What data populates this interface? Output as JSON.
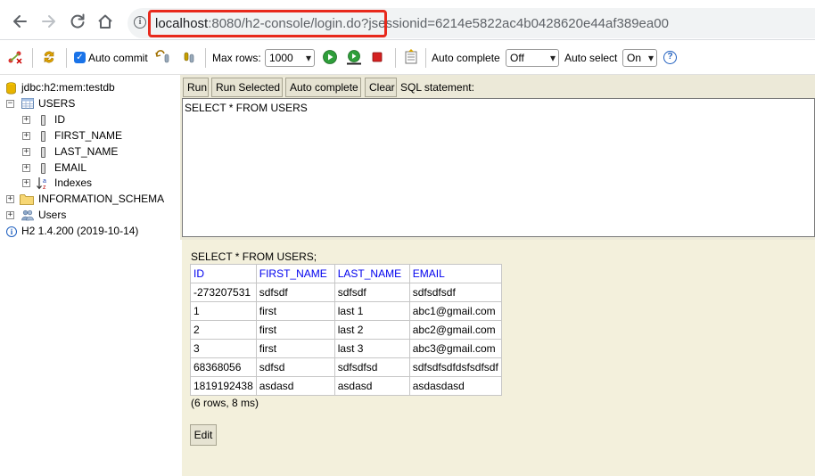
{
  "browser": {
    "url_host": "localhost",
    "url_rest": ":8080/h2-console/login.do?jsessionid=6214e5822ac4b0428620e44af389ea00",
    "info_icon": "info-icon"
  },
  "toolbar": {
    "auto_commit_label": "Auto commit",
    "max_rows_label": "Max rows:",
    "max_rows_value": "1000",
    "auto_complete_label": "Auto complete",
    "auto_complete_value": "Off",
    "auto_select_label": "Auto select",
    "auto_select_value": "On",
    "help_icon": "?"
  },
  "tree": {
    "connection": "jdbc:h2:mem:testdb",
    "table": "USERS",
    "columns": [
      "ID",
      "FIRST_NAME",
      "LAST_NAME",
      "EMAIL"
    ],
    "indexes": "Indexes",
    "schema": "INFORMATION_SCHEMA",
    "users": "Users",
    "version": "H2 1.4.200 (2019-10-14)"
  },
  "query": {
    "run_label": "Run",
    "run_selected_label": "Run Selected",
    "auto_complete_label": "Auto complete",
    "clear_label": "Clear",
    "sql_statement_label": "SQL statement:",
    "sql_text": "SELECT * FROM USERS"
  },
  "result": {
    "executed_sql": "SELECT * FROM USERS;",
    "headers": [
      "ID",
      "FIRST_NAME",
      "LAST_NAME",
      "EMAIL"
    ],
    "rows": [
      [
        "-273207531",
        "sdfsdf",
        "sdfsdf",
        "sdfsdfsdf"
      ],
      [
        "1",
        "first",
        "last 1",
        "abc1@gmail.com"
      ],
      [
        "2",
        "first",
        "last 2",
        "abc2@gmail.com"
      ],
      [
        "3",
        "first",
        "last 3",
        "abc3@gmail.com"
      ],
      [
        "68368056",
        "sdfsd",
        "sdfsdfsd",
        "sdfsdfsdfdsfsdfsdf"
      ],
      [
        "1819192438",
        "asdasd",
        "asdasd",
        "asdasdasd"
      ]
    ],
    "status": "(6 rows, 8 ms)",
    "edit_label": "Edit"
  }
}
